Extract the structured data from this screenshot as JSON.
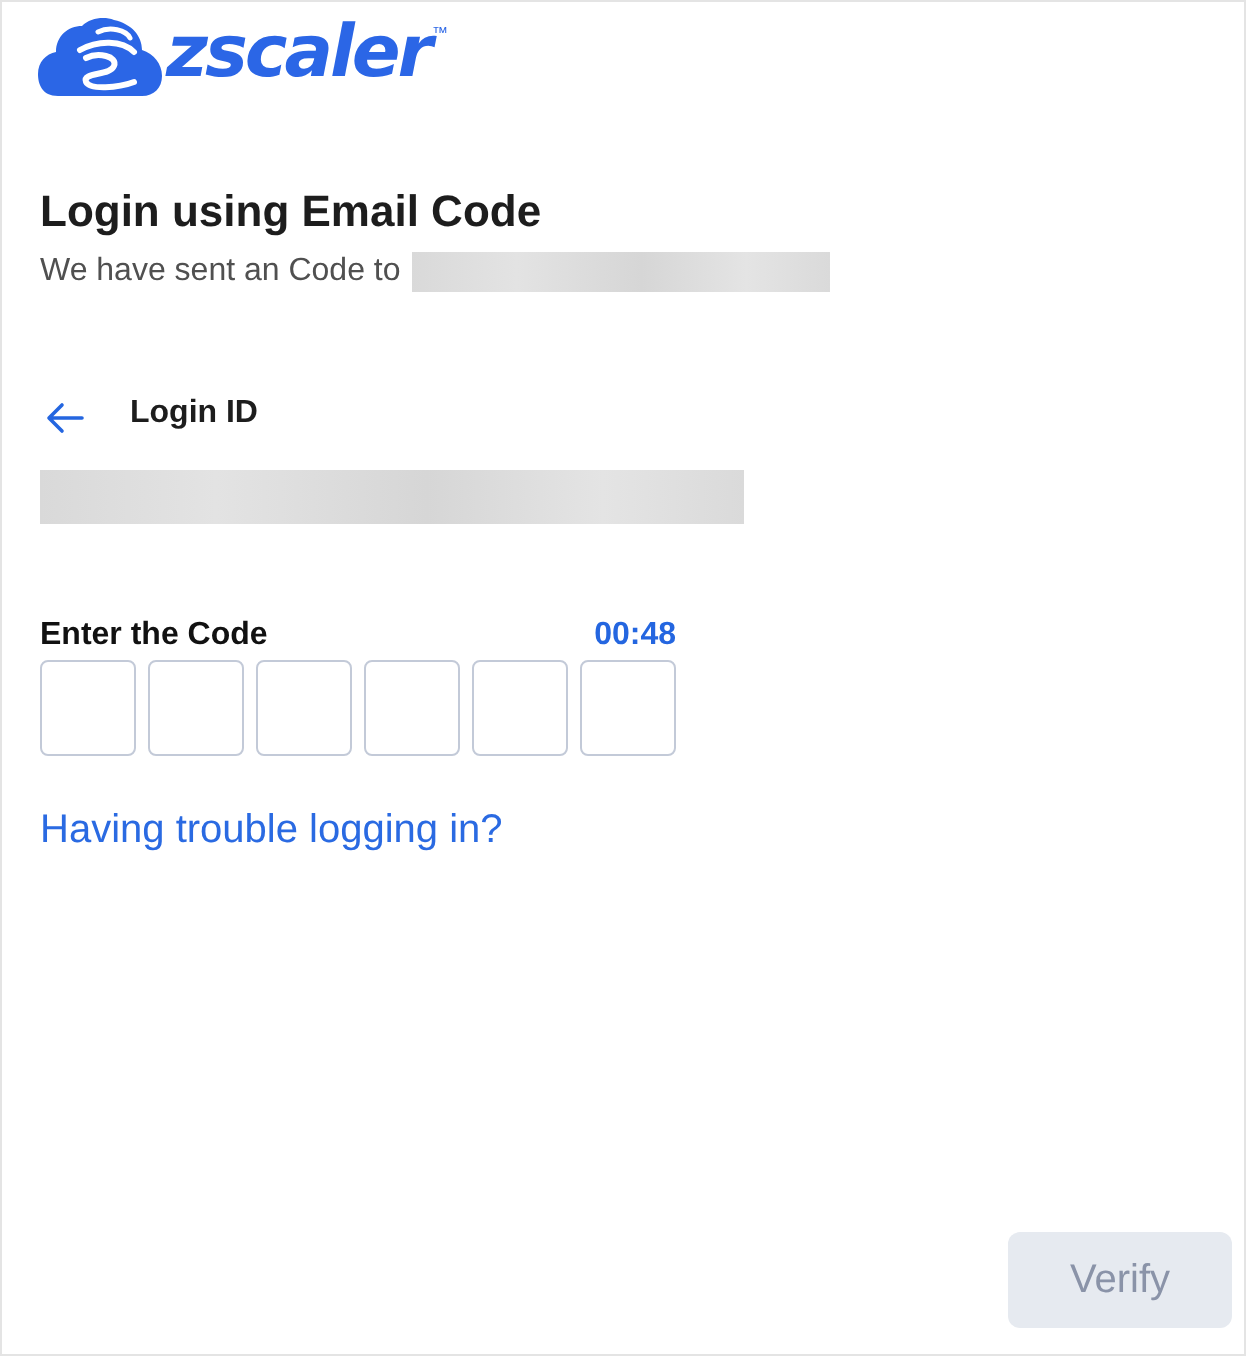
{
  "logo": {
    "wordmark": "zscaler",
    "trademark": "™"
  },
  "title": "Login using Email Code",
  "subtitle": {
    "text": "We have sent an Code to",
    "email_redacted": true
  },
  "login_id": {
    "label": "Login ID",
    "value_redacted": true
  },
  "code": {
    "label": "Enter the Code",
    "timer": "00:48",
    "boxes": [
      {
        "focused": false
      },
      {
        "focused": false
      },
      {
        "focused": false
      },
      {
        "focused": false
      },
      {
        "focused": false
      },
      {
        "focused": false
      }
    ]
  },
  "help_link": "Having trouble logging in?",
  "verify_button": {
    "label": "Verify",
    "disabled": true
  }
}
